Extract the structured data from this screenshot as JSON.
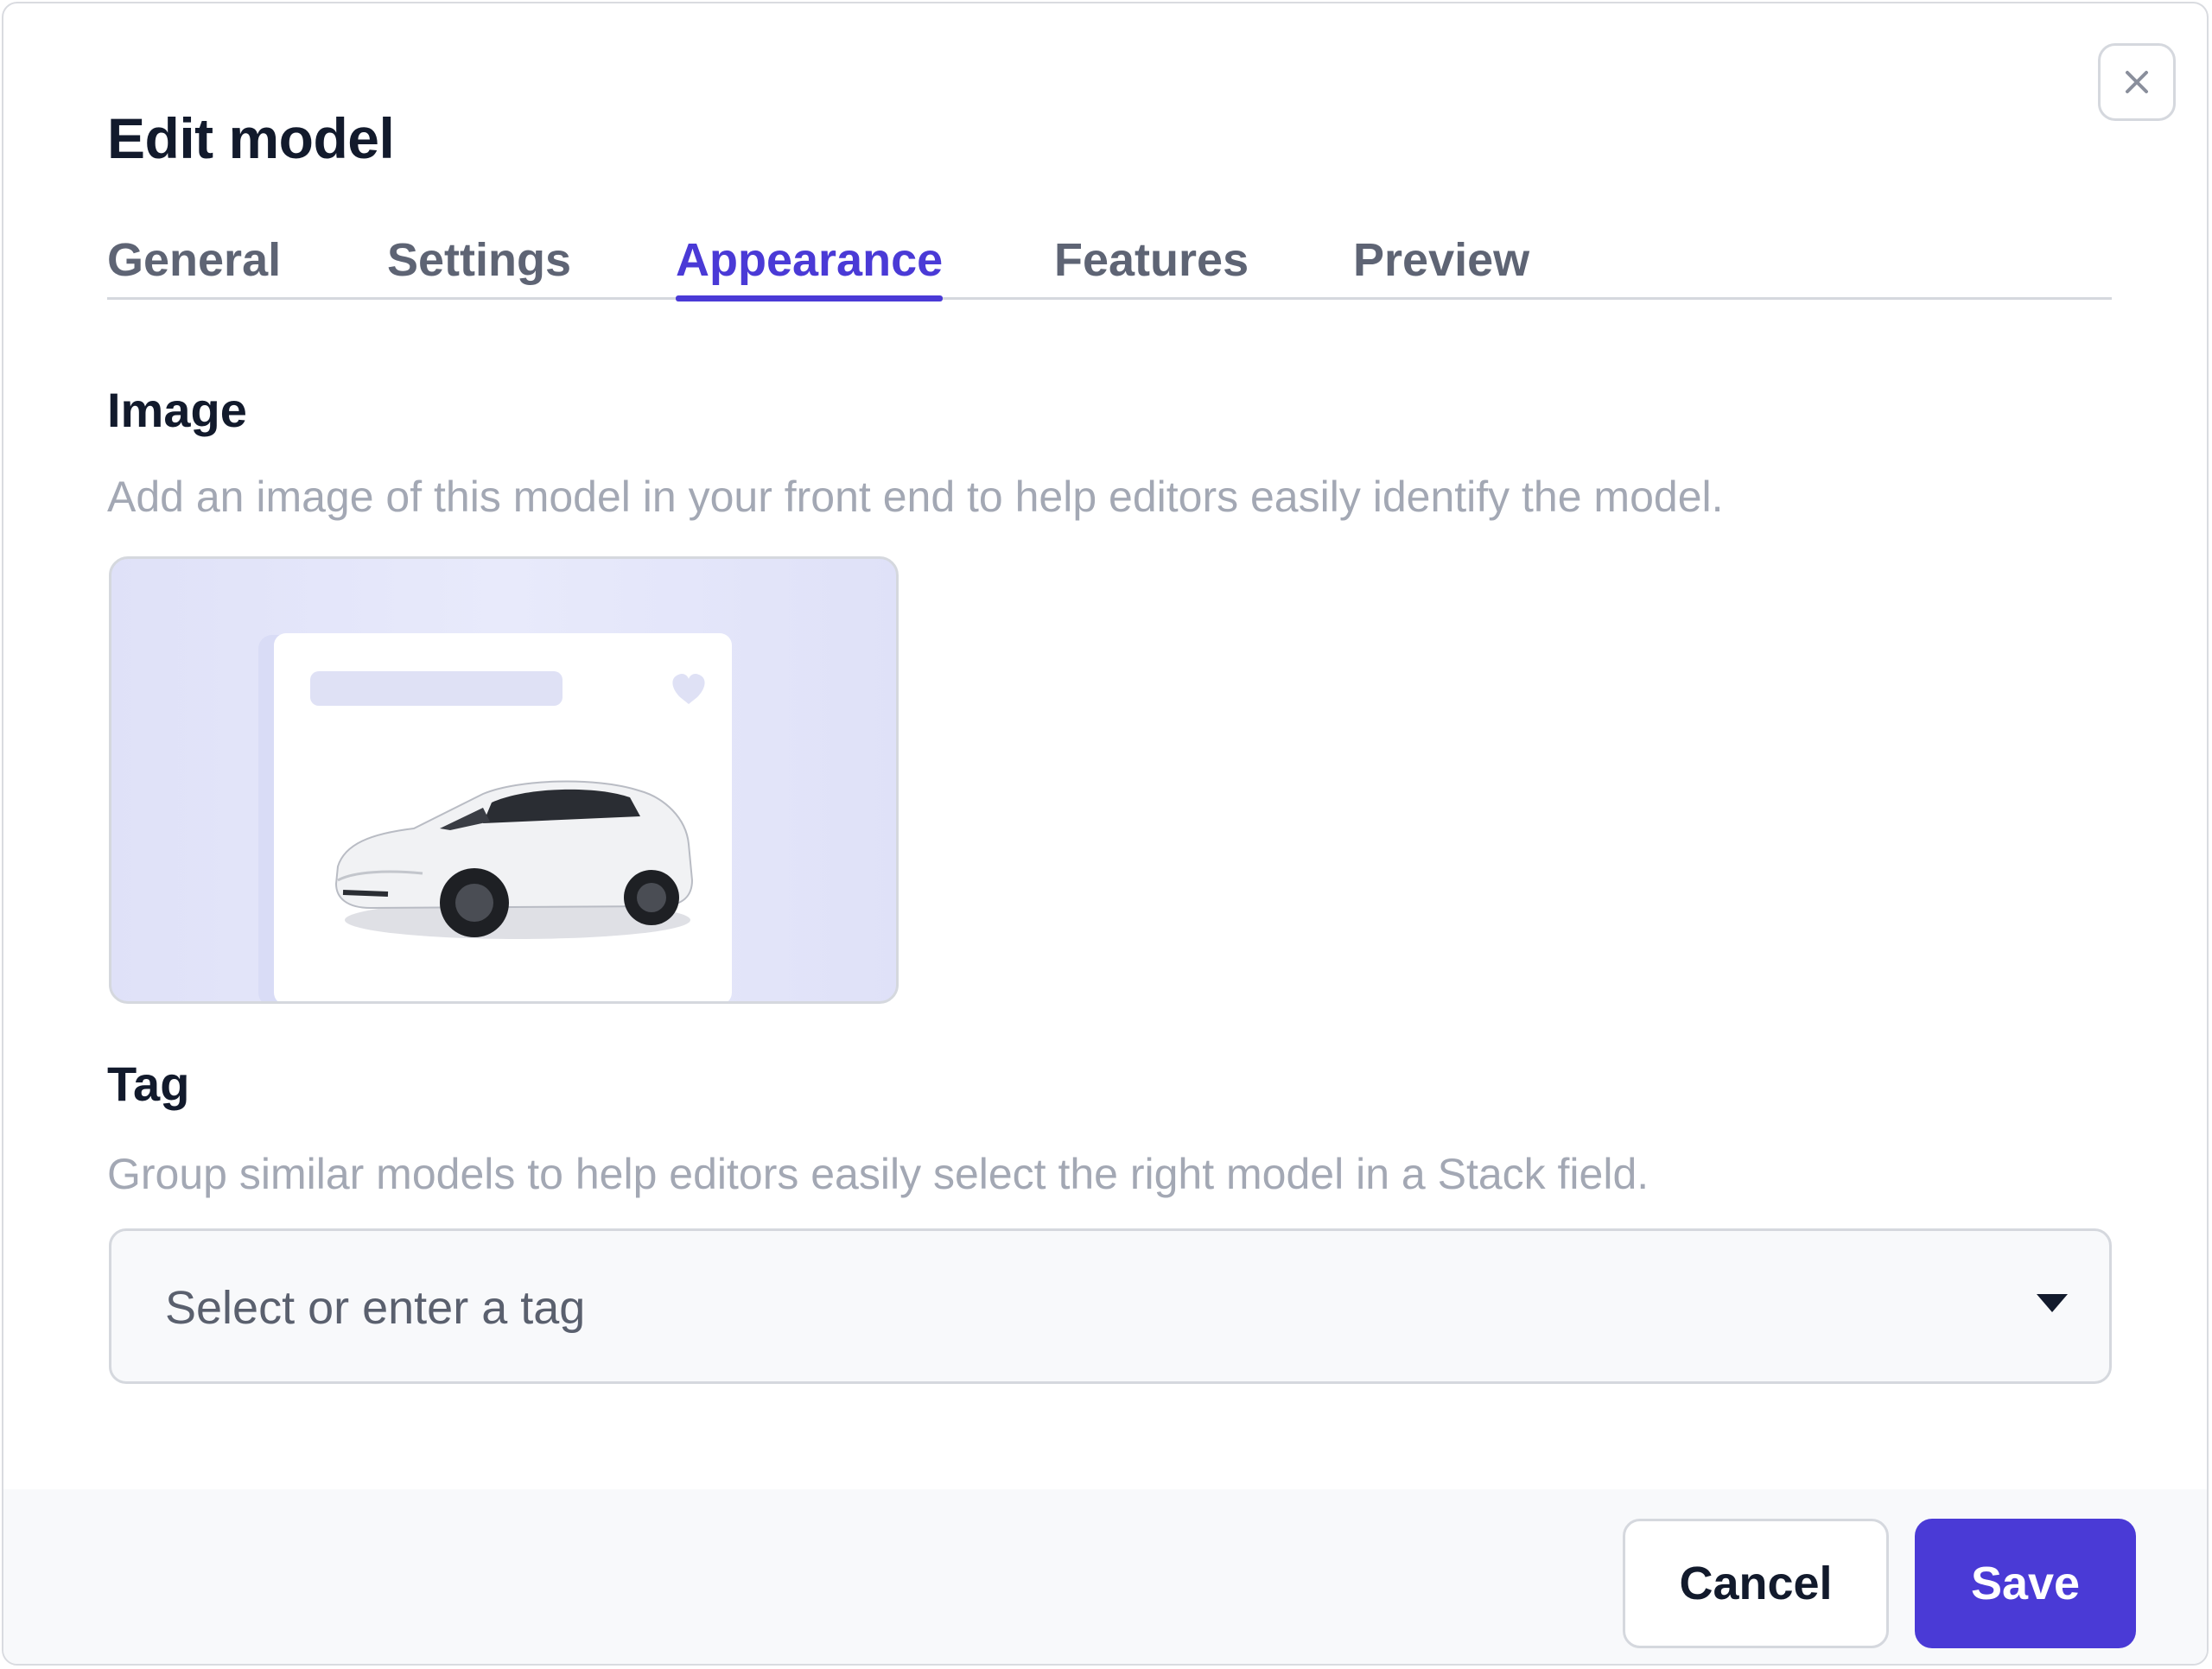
{
  "dialog": {
    "title": "Edit model",
    "close_icon": "close-icon"
  },
  "tabs": [
    {
      "label": "General",
      "active": false
    },
    {
      "label": "Settings",
      "active": false
    },
    {
      "label": "Appearance",
      "active": true
    },
    {
      "label": "Features",
      "active": false
    },
    {
      "label": "Preview",
      "active": false
    }
  ],
  "image_section": {
    "title": "Image",
    "description": "Add an image of this model in your front end to help editors easily identify the model."
  },
  "tag_section": {
    "title": "Tag",
    "description": "Group similar models to help editors easily select the right model in a Stack field.",
    "placeholder": "Select or enter a tag",
    "caret_icon": "caret-down-icon"
  },
  "footer": {
    "cancel_label": "Cancel",
    "save_label": "Save"
  },
  "colors": {
    "accent": "#4a3ad6",
    "text_primary": "#121a2c",
    "text_muted": "#a3a8b4",
    "border": "#d5d8de"
  }
}
